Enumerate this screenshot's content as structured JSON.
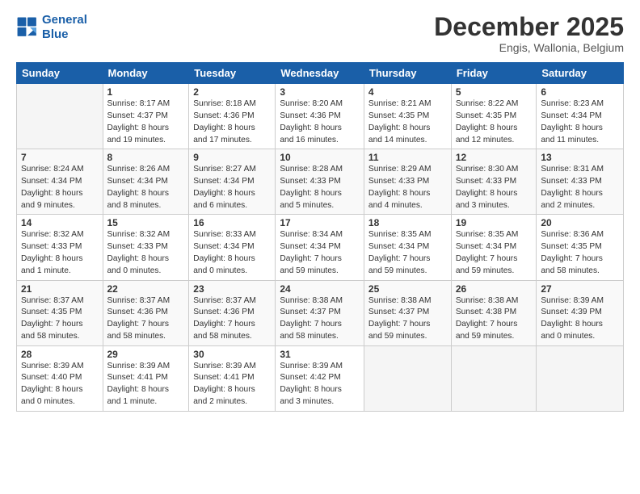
{
  "logo": {
    "line1": "General",
    "line2": "Blue"
  },
  "title": "December 2025",
  "subtitle": "Engis, Wallonia, Belgium",
  "days_header": [
    "Sunday",
    "Monday",
    "Tuesday",
    "Wednesday",
    "Thursday",
    "Friday",
    "Saturday"
  ],
  "weeks": [
    [
      {
        "num": "",
        "info": ""
      },
      {
        "num": "1",
        "info": "Sunrise: 8:17 AM\nSunset: 4:37 PM\nDaylight: 8 hours\nand 19 minutes."
      },
      {
        "num": "2",
        "info": "Sunrise: 8:18 AM\nSunset: 4:36 PM\nDaylight: 8 hours\nand 17 minutes."
      },
      {
        "num": "3",
        "info": "Sunrise: 8:20 AM\nSunset: 4:36 PM\nDaylight: 8 hours\nand 16 minutes."
      },
      {
        "num": "4",
        "info": "Sunrise: 8:21 AM\nSunset: 4:35 PM\nDaylight: 8 hours\nand 14 minutes."
      },
      {
        "num": "5",
        "info": "Sunrise: 8:22 AM\nSunset: 4:35 PM\nDaylight: 8 hours\nand 12 minutes."
      },
      {
        "num": "6",
        "info": "Sunrise: 8:23 AM\nSunset: 4:34 PM\nDaylight: 8 hours\nand 11 minutes."
      }
    ],
    [
      {
        "num": "7",
        "info": "Sunrise: 8:24 AM\nSunset: 4:34 PM\nDaylight: 8 hours\nand 9 minutes."
      },
      {
        "num": "8",
        "info": "Sunrise: 8:26 AM\nSunset: 4:34 PM\nDaylight: 8 hours\nand 8 minutes."
      },
      {
        "num": "9",
        "info": "Sunrise: 8:27 AM\nSunset: 4:34 PM\nDaylight: 8 hours\nand 6 minutes."
      },
      {
        "num": "10",
        "info": "Sunrise: 8:28 AM\nSunset: 4:33 PM\nDaylight: 8 hours\nand 5 minutes."
      },
      {
        "num": "11",
        "info": "Sunrise: 8:29 AM\nSunset: 4:33 PM\nDaylight: 8 hours\nand 4 minutes."
      },
      {
        "num": "12",
        "info": "Sunrise: 8:30 AM\nSunset: 4:33 PM\nDaylight: 8 hours\nand 3 minutes."
      },
      {
        "num": "13",
        "info": "Sunrise: 8:31 AM\nSunset: 4:33 PM\nDaylight: 8 hours\nand 2 minutes."
      }
    ],
    [
      {
        "num": "14",
        "info": "Sunrise: 8:32 AM\nSunset: 4:33 PM\nDaylight: 8 hours\nand 1 minute."
      },
      {
        "num": "15",
        "info": "Sunrise: 8:32 AM\nSunset: 4:33 PM\nDaylight: 8 hours\nand 0 minutes."
      },
      {
        "num": "16",
        "info": "Sunrise: 8:33 AM\nSunset: 4:34 PM\nDaylight: 8 hours\nand 0 minutes."
      },
      {
        "num": "17",
        "info": "Sunrise: 8:34 AM\nSunset: 4:34 PM\nDaylight: 7 hours\nand 59 minutes."
      },
      {
        "num": "18",
        "info": "Sunrise: 8:35 AM\nSunset: 4:34 PM\nDaylight: 7 hours\nand 59 minutes."
      },
      {
        "num": "19",
        "info": "Sunrise: 8:35 AM\nSunset: 4:34 PM\nDaylight: 7 hours\nand 59 minutes."
      },
      {
        "num": "20",
        "info": "Sunrise: 8:36 AM\nSunset: 4:35 PM\nDaylight: 7 hours\nand 58 minutes."
      }
    ],
    [
      {
        "num": "21",
        "info": "Sunrise: 8:37 AM\nSunset: 4:35 PM\nDaylight: 7 hours\nand 58 minutes."
      },
      {
        "num": "22",
        "info": "Sunrise: 8:37 AM\nSunset: 4:36 PM\nDaylight: 7 hours\nand 58 minutes."
      },
      {
        "num": "23",
        "info": "Sunrise: 8:37 AM\nSunset: 4:36 PM\nDaylight: 7 hours\nand 58 minutes."
      },
      {
        "num": "24",
        "info": "Sunrise: 8:38 AM\nSunset: 4:37 PM\nDaylight: 7 hours\nand 58 minutes."
      },
      {
        "num": "25",
        "info": "Sunrise: 8:38 AM\nSunset: 4:37 PM\nDaylight: 7 hours\nand 59 minutes."
      },
      {
        "num": "26",
        "info": "Sunrise: 8:38 AM\nSunset: 4:38 PM\nDaylight: 7 hours\nand 59 minutes."
      },
      {
        "num": "27",
        "info": "Sunrise: 8:39 AM\nSunset: 4:39 PM\nDaylight: 8 hours\nand 0 minutes."
      }
    ],
    [
      {
        "num": "28",
        "info": "Sunrise: 8:39 AM\nSunset: 4:40 PM\nDaylight: 8 hours\nand 0 minutes."
      },
      {
        "num": "29",
        "info": "Sunrise: 8:39 AM\nSunset: 4:41 PM\nDaylight: 8 hours\nand 1 minute."
      },
      {
        "num": "30",
        "info": "Sunrise: 8:39 AM\nSunset: 4:41 PM\nDaylight: 8 hours\nand 2 minutes."
      },
      {
        "num": "31",
        "info": "Sunrise: 8:39 AM\nSunset: 4:42 PM\nDaylight: 8 hours\nand 3 minutes."
      },
      {
        "num": "",
        "info": ""
      },
      {
        "num": "",
        "info": ""
      },
      {
        "num": "",
        "info": ""
      }
    ]
  ]
}
